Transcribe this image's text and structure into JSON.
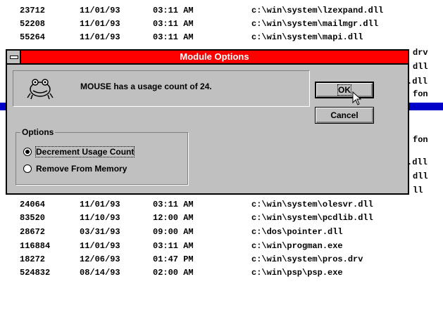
{
  "file_list": [
    {
      "size": "23712",
      "date": "11/01/93",
      "time": "03:11 AM",
      "path": "c:\\win\\system\\lzexpand.dll"
    },
    {
      "size": "52208",
      "date": "11/01/93",
      "time": "03:11 AM",
      "path": "c:\\win\\system\\mailmgr.dll"
    },
    {
      "size": "55264",
      "date": "11/01/93",
      "time": "03:11 AM",
      "path": "c:\\win\\system\\mapi.dll"
    },
    {
      "size": "24064",
      "date": "11/01/93",
      "time": "03:11 AM",
      "path": "c:\\win\\system\\olesvr.dll"
    },
    {
      "size": "83520",
      "date": "11/10/93",
      "time": "12:00 AM",
      "path": "c:\\win\\system\\pcdlib.dll"
    },
    {
      "size": "28672",
      "date": "03/31/93",
      "time": "09:00 AM",
      "path": "c:\\dos\\pointer.dll"
    },
    {
      "size": "116884",
      "date": "11/01/93",
      "time": "03:11 AM",
      "path": "c:\\win\\progman.exe"
    },
    {
      "size": "18272",
      "date": "12/06/93",
      "time": "01:47 PM",
      "path": "c:\\win\\system\\pros.drv"
    },
    {
      "size": "524832",
      "date": "08/14/93",
      "time": "02:00 AM",
      "path": "c:\\win\\psp\\psp.exe"
    }
  ],
  "right_fragments": [
    "drv",
    "dll",
    ".dll",
    "fon",
    "fon",
    ".dll",
    "dll",
    "ll"
  ],
  "dialog": {
    "title": "Module Options",
    "message": "MOUSE has a usage count of 24.",
    "ok_label": "OK",
    "cancel_label": "Cancel",
    "options_label": "Options",
    "options": [
      {
        "label": "Decrement Usage Count",
        "selected": true
      },
      {
        "label": "Remove From Memory",
        "selected": false
      }
    ]
  },
  "colors": {
    "title_bar": "#ff0000",
    "highlight_row": "#0000c8",
    "dialog_face": "#c0c0c0"
  }
}
